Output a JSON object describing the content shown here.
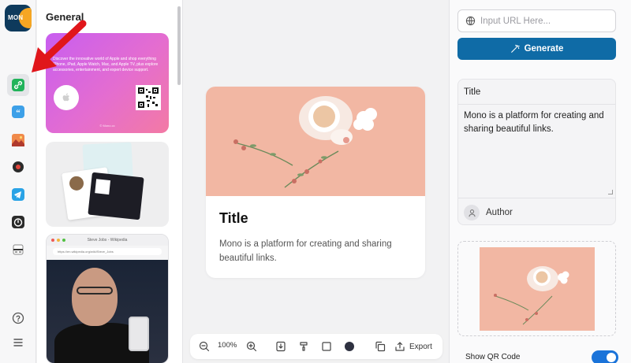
{
  "app": {
    "logo_text": "MON",
    "brand_colors": {
      "logo_bg": "#0e3a5c",
      "logo_accent": "#f6a623",
      "primary": "#0f6ba6",
      "toggle_on": "#1a73d9"
    }
  },
  "rail": {
    "items": [
      {
        "name": "link-icon",
        "active": true
      },
      {
        "name": "quote-icon",
        "active": false
      },
      {
        "name": "image-icon",
        "active": false
      },
      {
        "name": "record-icon",
        "active": false
      },
      {
        "name": "telegram-icon",
        "active": false
      },
      {
        "name": "timer-icon",
        "active": false
      },
      {
        "name": "layout-icon",
        "active": false
      },
      {
        "name": "help-icon",
        "active": false
      },
      {
        "name": "menu-icon",
        "active": false
      }
    ]
  },
  "templates": {
    "section_title": "General",
    "items": [
      {
        "kind": "apple-card",
        "text": "Discover the innovative world of Apple and shop everything iPhone, iPad, Apple Watch, Mac, and Apple TV, plus explore accessories, entertainment, and expert device support.",
        "footer": "© Mono.cc"
      },
      {
        "kind": "quote-cards"
      },
      {
        "kind": "browser-card",
        "browser_title": "Steve Jobs - Wikipedia",
        "browser_url": "https://en.wikipedia.org/wiki/Steve_Jobs"
      }
    ]
  },
  "preview": {
    "title": "Title",
    "description": "Mono is a platform for creating and sharing beautiful links."
  },
  "toolbar": {
    "zoom": "100%",
    "export_label": "Export",
    "color_swatch": "#2e3140"
  },
  "settings": {
    "url_placeholder": "Input URL Here...",
    "generate_label": "Generate",
    "title_value": "Title",
    "description_value": "Mono is a platform for creating and sharing beautiful links.",
    "author_value": "Author",
    "show_qr_label": "Show QR Code",
    "show_qr_enabled": true
  }
}
